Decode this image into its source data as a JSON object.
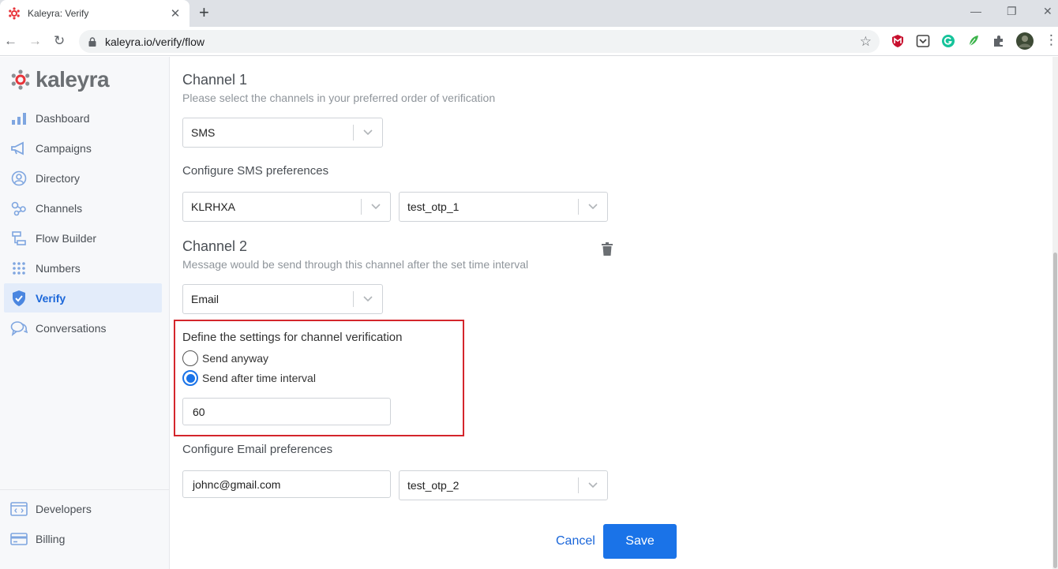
{
  "browser": {
    "tab_title": "Kaleyra: Verify",
    "url": "kaleyra.io/verify/flow"
  },
  "sidebar": {
    "brand": "kaleyra",
    "items": [
      {
        "label": "Dashboard",
        "icon": "bar-chart-icon"
      },
      {
        "label": "Campaigns",
        "icon": "megaphone-icon"
      },
      {
        "label": "Directory",
        "icon": "user-circle-icon"
      },
      {
        "label": "Channels",
        "icon": "share-nodes-icon"
      },
      {
        "label": "Flow Builder",
        "icon": "flow-icon"
      },
      {
        "label": "Numbers",
        "icon": "dial-pad-icon"
      },
      {
        "label": "Verify",
        "icon": "shield-check-icon",
        "active": true
      },
      {
        "label": "Conversations",
        "icon": "chat-bubbles-icon"
      }
    ],
    "bottom_items": [
      {
        "label": "Developers",
        "icon": "code-window-icon"
      },
      {
        "label": "Billing",
        "icon": "credit-card-icon"
      }
    ]
  },
  "channel1": {
    "heading": "Channel 1",
    "subtitle": "Please select the channels in your preferred order of verification",
    "channel_value": "SMS",
    "prefs_label": "Configure SMS preferences",
    "sender_value": "KLRHXA",
    "template_value": "test_otp_1"
  },
  "channel2": {
    "heading": "Channel 2",
    "subtitle": "Message would be send through this channel after the set time interval",
    "channel_value": "Email",
    "settings_title": "Define the settings for channel verification",
    "radio_send_anyway": "Send anyway",
    "radio_send_after": "Send after time interval",
    "selected_option": "Send after time interval",
    "interval_value": "60",
    "prefs_label": "Configure Email preferences",
    "email_value": "johnc@gmail.com",
    "template_value": "test_otp_2"
  },
  "actions": {
    "cancel_label": "Cancel",
    "save_label": "Save"
  },
  "colors": {
    "accent": "#1a73e8",
    "highlight_border": "#d4262c",
    "brand_red": "#e8343a"
  }
}
